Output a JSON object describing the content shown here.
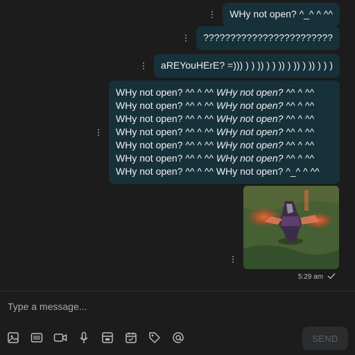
{
  "messages": [
    {
      "text": "WHy not open? ^_^ ^ ^^"
    },
    {
      "text": "????????????????????????"
    },
    {
      "text": "aREYouHErE? =))) ) ) )) ) ) )) ) )) ) )) ) ) )"
    },
    {
      "segments": [
        "WHy not open? ^^ ^ ^^",
        "WHy not open? ^^ ^ ^^",
        "WHy not open? ^^ ^ ^^",
        "WHy not open? ^^ ^ ^^",
        "WHy not open? ^^ ^ ^^",
        "WHy not open? ^^ ^ ^^",
        "WHy not open? ^^ ^ ^^",
        "WHy not open? ^^ ^ ^^",
        "WHy not open? ^^ ^ ^^",
        "WHy not open? ^^ ^ ^^",
        "WHy not open? ^^ ^ ^^",
        "WHy not open? ^^ ^ ^^",
        "WHy not open? ^^ ^ ^^",
        "WHy not open? ^_^ ^ ^^"
      ]
    }
  ],
  "image_message": {
    "timestamp": "5:29 am",
    "status_icon": "check-icon"
  },
  "composer": {
    "placeholder": "Type a message...",
    "send_label": "SEND",
    "tools": [
      "image-icon",
      "gif-icon",
      "video-icon",
      "microphone-icon",
      "sticker-icon",
      "calendar-icon",
      "tag-icon",
      "at-icon"
    ]
  },
  "colors": {
    "background": "#1c1c1d",
    "bubble": "#17313a",
    "send_disabled": "#2a2c2e"
  }
}
